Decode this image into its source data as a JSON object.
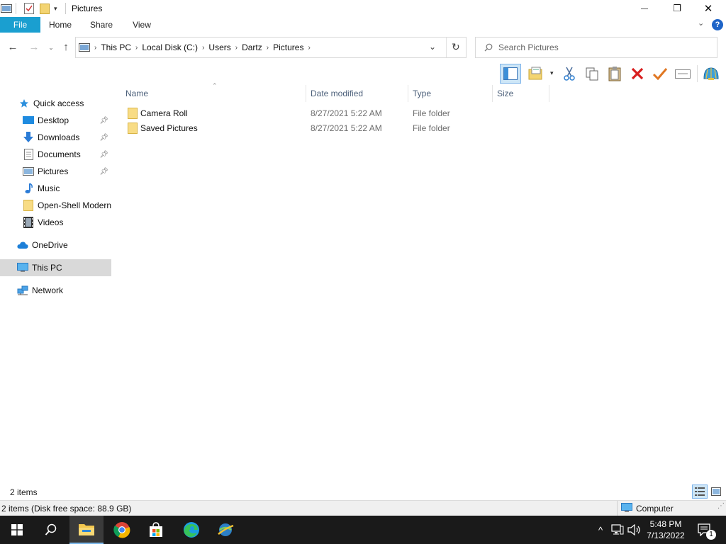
{
  "window": {
    "title": "Pictures",
    "controls": {
      "minimize": "—",
      "maximize": "❐",
      "close": "✕"
    }
  },
  "ribbon": {
    "tabs": [
      "File",
      "Home",
      "Share",
      "View"
    ]
  },
  "address": {
    "crumbs": [
      "This PC",
      "Local Disk (C:)",
      "Users",
      "Dartz",
      "Pictures"
    ]
  },
  "search": {
    "placeholder": "Search Pictures"
  },
  "nav": {
    "items": [
      {
        "label": "Quick access",
        "icon": "star-icon"
      },
      {
        "label": "Desktop",
        "icon": "desktop-icon",
        "pinned": true
      },
      {
        "label": "Downloads",
        "icon": "download-arrow-icon",
        "pinned": true
      },
      {
        "label": "Documents",
        "icon": "document-icon",
        "pinned": true
      },
      {
        "label": "Pictures",
        "icon": "pictures-icon",
        "pinned": true
      },
      {
        "label": "Music",
        "icon": "music-note-icon"
      },
      {
        "label": "Open-Shell Modern",
        "icon": "folder-icon"
      },
      {
        "label": "Videos",
        "icon": "film-icon"
      },
      {
        "label": "OneDrive",
        "icon": "cloud-icon"
      },
      {
        "label": "This PC",
        "icon": "computer-icon",
        "selected": true
      },
      {
        "label": "Network",
        "icon": "network-icon"
      }
    ]
  },
  "columns": [
    "Name",
    "Date modified",
    "Type",
    "Size"
  ],
  "files": [
    {
      "name": "Camera Roll",
      "date": "8/27/2021 5:22 AM",
      "type": "File folder",
      "size": ""
    },
    {
      "name": "Saved Pictures",
      "date": "8/27/2021 5:22 AM",
      "type": "File folder",
      "size": ""
    }
  ],
  "status": {
    "items": "2 items",
    "disk": "2 items (Disk free space: 88.9 GB)",
    "location": "Computer"
  },
  "clock": {
    "time": "5:48 PM",
    "date": "7/13/2022"
  },
  "notifications": {
    "count": "1"
  },
  "colors": {
    "accent": "#1a9fd0",
    "folder": "#f3c74e",
    "taskbar": "#1a1a1a"
  }
}
